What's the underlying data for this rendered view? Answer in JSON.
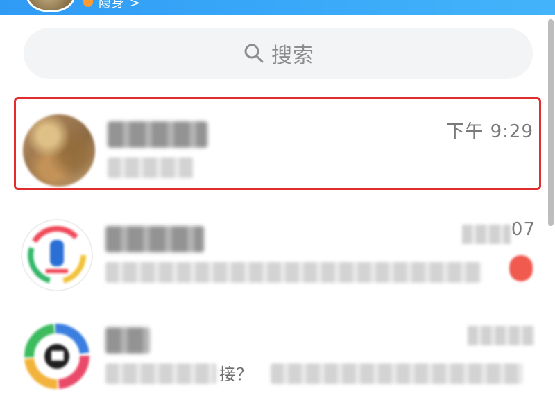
{
  "header": {
    "status_text": "隐身 >"
  },
  "search": {
    "placeholder": "搜索"
  },
  "conversations": [
    {
      "time": "下午 9:29",
      "selected": true
    },
    {
      "time_visible_suffix": "07",
      "has_badge": true
    },
    {
      "message_visible_fragment": "接？"
    }
  ],
  "colors": {
    "header_gradient_start": "#2f9bf5",
    "header_gradient_end": "#43b4fb",
    "highlight_border": "#e12d2d",
    "badge": "#f05a4f",
    "search_bg": "#f3f4f6"
  },
  "icons": [
    "search-icon",
    "avatar",
    "status-dot"
  ]
}
